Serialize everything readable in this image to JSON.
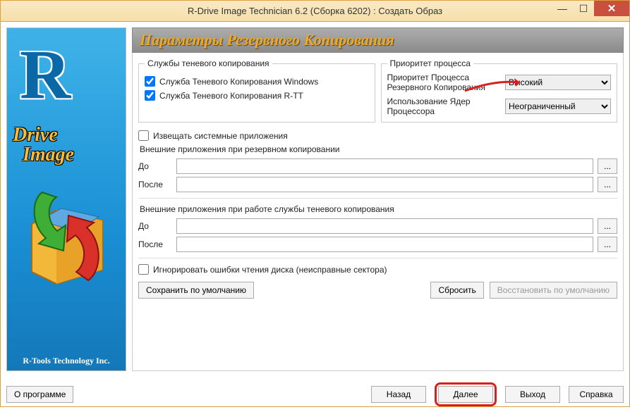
{
  "window": {
    "title": "R-Drive Image Technician 6.2 (Сборка 6202) : Создать Образ"
  },
  "sidebar": {
    "brand_line1": "Drive",
    "brand_line2": "Image",
    "copyright": "R-Tools Technology Inc."
  },
  "header": {
    "title": "Параметры Резервного Копирования"
  },
  "shadow": {
    "legend": "Службы теневого копирования",
    "opt_windows": "Служба Теневого Копирования Windows",
    "opt_rtt": "Служба Теневого Копирования R-TT"
  },
  "priority": {
    "legend": "Приоритет процесса",
    "priority_label": "Приоритет Процесса Резервного Копирования",
    "priority_value": "Высокий",
    "cores_label": "Использование Ядер Процессора",
    "cores_value": "Неограниченный"
  },
  "notify": {
    "label": "Извещать системные приложения"
  },
  "ext_backup": {
    "legend": "Внешние приложения при резервном копировании",
    "before_label": "До",
    "after_label": "После",
    "before_value": "",
    "after_value": ""
  },
  "ext_shadow": {
    "legend": "Внешние приложения при работе службы теневого копирования",
    "before_label": "До",
    "after_label": "После",
    "before_value": "",
    "after_value": ""
  },
  "ignore": {
    "label": "Игнорировать ошибки чтения диска (неисправные сектора)"
  },
  "buttons": {
    "save_default": "Сохранить по умолчанию",
    "reset": "Сбросить",
    "restore_default": "Восстановить по умолчанию",
    "browse": "...",
    "about": "О программе",
    "back": "Назад",
    "next": "Далее",
    "exit": "Выход",
    "help": "Справка"
  }
}
